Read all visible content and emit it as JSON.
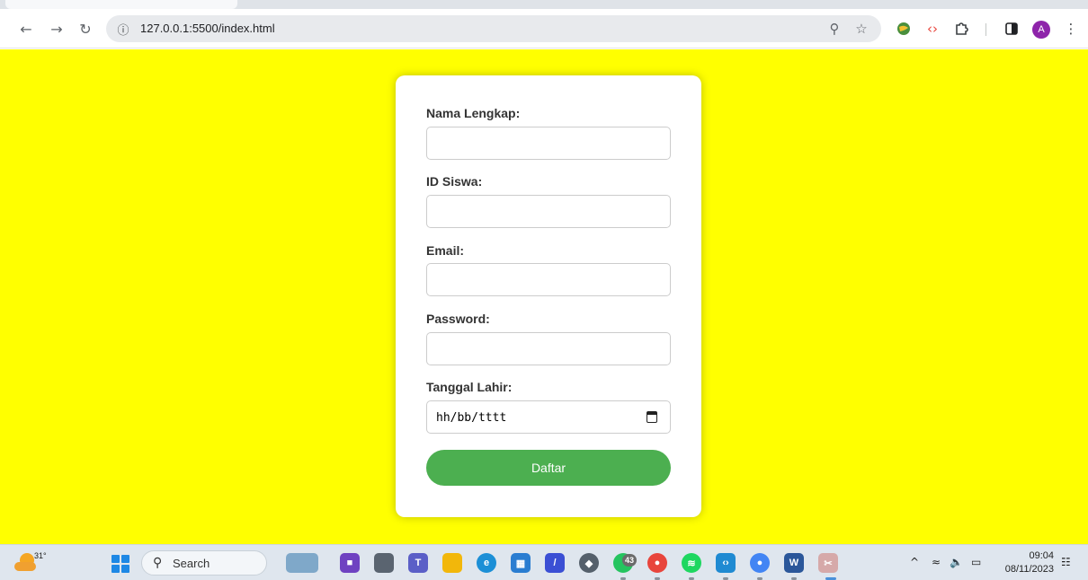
{
  "browser": {
    "url": "127.0.0.1:5500/index.html",
    "profile_initial": "A"
  },
  "form": {
    "fields": [
      {
        "label": "Nama Lengkap:",
        "value": ""
      },
      {
        "label": "ID Siswa:",
        "value": ""
      },
      {
        "label": "Email:",
        "value": ""
      },
      {
        "label": "Password:",
        "value": ""
      },
      {
        "label": "Tanggal Lahir:",
        "value": "hh/bb/tttt"
      }
    ],
    "submit_label": "Daftar"
  },
  "taskbar": {
    "weather_temp": "31°",
    "search_label": "Search",
    "whatsapp_badge": "43",
    "time": "09:04",
    "date": "08/11/2023"
  },
  "colors": {
    "page_background": "#ffff00",
    "submit_button": "#4caf50",
    "card": "#ffffff"
  }
}
